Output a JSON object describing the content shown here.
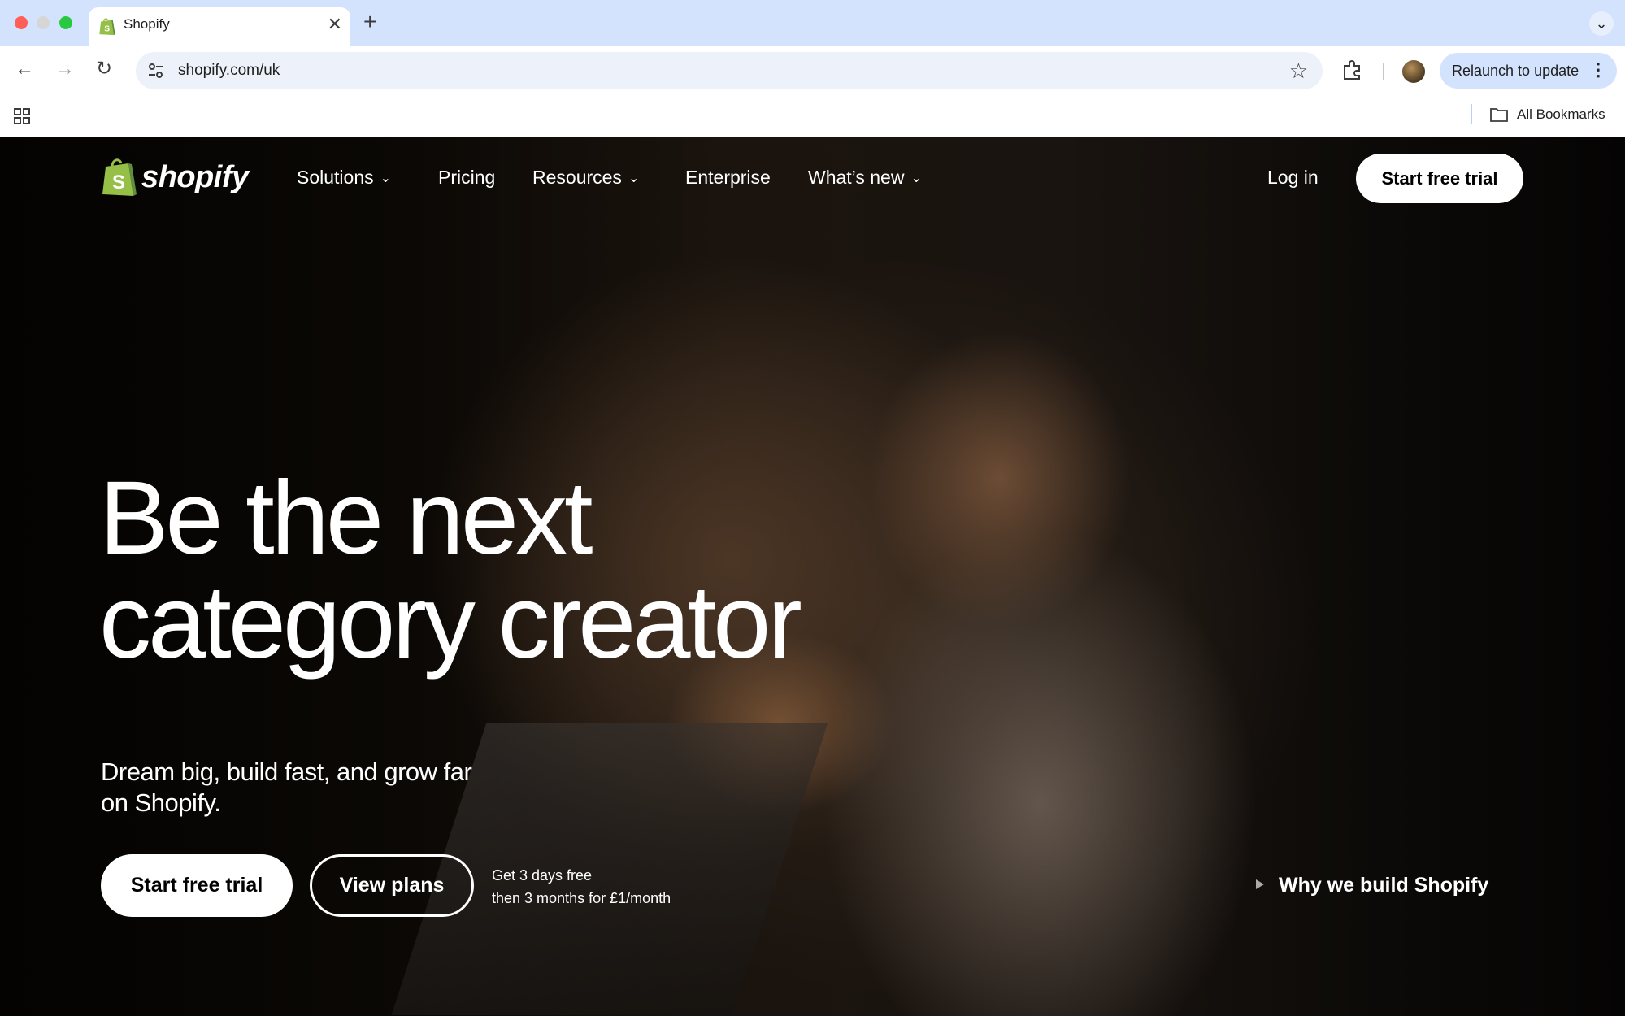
{
  "browser": {
    "tab_title": "Shopify",
    "tab_close": "✕",
    "new_tab": "+",
    "tab_search": "⌄",
    "back": "←",
    "forward": "→",
    "reload": "↻",
    "url": "shopify.com/uk",
    "bookmark_star": "☆",
    "relaunch_label": "Relaunch to update",
    "menu": "⋮",
    "bookmarks_label": "All Bookmarks"
  },
  "header": {
    "logo_text": "shopify",
    "nav": [
      {
        "label": "Solutions",
        "has_dropdown": true
      },
      {
        "label": "Pricing",
        "has_dropdown": false
      },
      {
        "label": "Resources",
        "has_dropdown": true
      },
      {
        "label": "Enterprise",
        "has_dropdown": false
      },
      {
        "label": "What’s new",
        "has_dropdown": true
      }
    ],
    "login": "Log in",
    "cta": "Start free trial"
  },
  "hero": {
    "headline_line1": "Be the next",
    "headline_line2": "category creator",
    "subhead": "Dream big, build fast, and grow far on Shopify.",
    "primary_cta": "Start free trial",
    "secondary_cta": "View plans",
    "offer_line1": "Get 3 days free",
    "offer_line2": "then 3 months for £1/month",
    "video_link": "Why we build Shopify"
  },
  "colors": {
    "brand_green": "#95bf47",
    "tabbar_bg": "#d3e3fd",
    "hero_bg": "#000000",
    "button_bg": "#ffffff"
  },
  "icons": [
    "shopify-bag-icon",
    "tune-icon",
    "star-icon",
    "extensions-icon",
    "apps-grid-icon",
    "folder-icon",
    "chevron-down-icon",
    "play-icon"
  ]
}
